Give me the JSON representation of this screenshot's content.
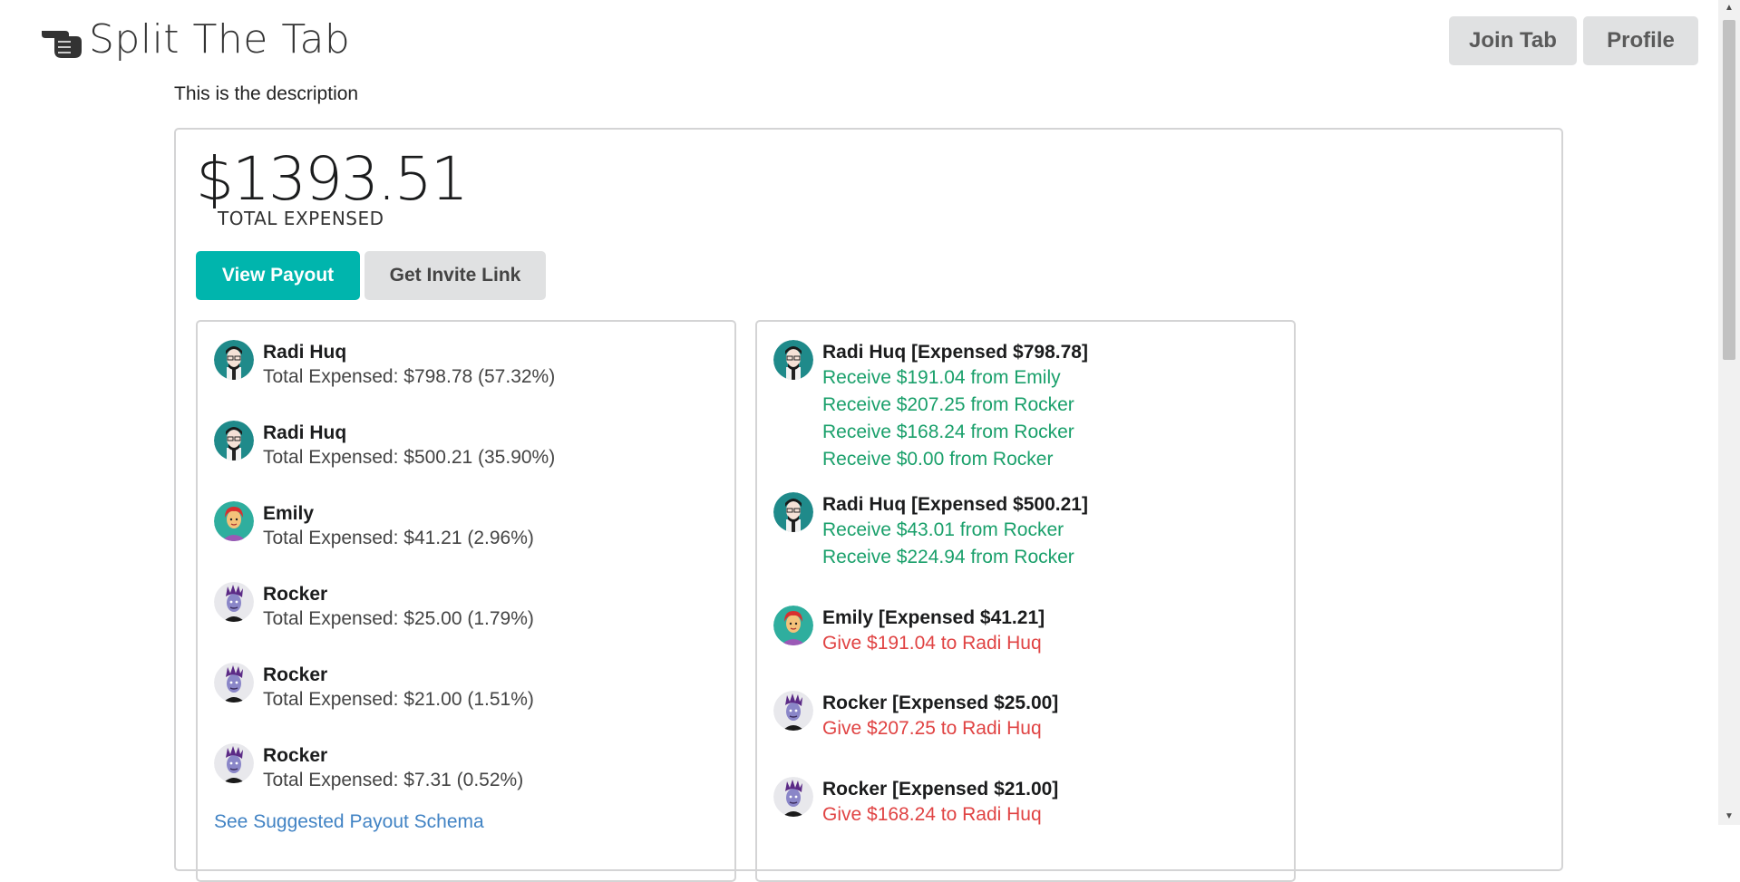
{
  "app": {
    "title": "Split The Tab",
    "logo_icon": "pointing-hand-icon"
  },
  "nav": {
    "join_label": "Join Tab",
    "profile_label": "Profile"
  },
  "tab": {
    "description": "This is the description",
    "total": "$1393.51",
    "total_label": "TOTAL EXPENSED",
    "view_payout_label": "View Payout",
    "invite_label": "Get Invite Link",
    "suggest_link": "See Suggested Payout Schema"
  },
  "colors": {
    "accent": "#00b5ad",
    "receive": "#1aa06b",
    "give": "#e04343",
    "link": "#4183c4"
  },
  "members": [
    {
      "name": "Radi Huq",
      "avatar": "radi-avatar-icon",
      "expensed": "Total Expensed: $798.78 (57.32%)"
    },
    {
      "name": "Radi Huq",
      "avatar": "radi-avatar-icon",
      "expensed": "Total Expensed: $500.21 (35.90%)"
    },
    {
      "name": "Emily",
      "avatar": "emily-avatar-icon",
      "expensed": "Total Expensed: $41.21 (2.96%)"
    },
    {
      "name": "Rocker",
      "avatar": "rocker-avatar-icon",
      "expensed": "Total Expensed: $25.00 (1.79%)"
    },
    {
      "name": "Rocker",
      "avatar": "rocker-avatar-icon",
      "expensed": "Total Expensed: $21.00 (1.51%)"
    },
    {
      "name": "Rocker",
      "avatar": "rocker-avatar-icon",
      "expensed": "Total Expensed: $7.31 (0.52%)"
    }
  ],
  "payouts": [
    {
      "title": "Radi Huq [Expensed $798.78]",
      "avatar": "radi-avatar-icon",
      "lines": [
        {
          "kind": "receive",
          "text": "Receive $191.04 from Emily"
        },
        {
          "kind": "receive",
          "text": "Receive $207.25 from Rocker"
        },
        {
          "kind": "receive",
          "text": "Receive $168.24 from Rocker"
        },
        {
          "kind": "receive",
          "text": "Receive $0.00 from Rocker"
        }
      ]
    },
    {
      "title": "Radi Huq [Expensed $500.21]",
      "avatar": "radi-avatar-icon",
      "lines": [
        {
          "kind": "receive",
          "text": "Receive $43.01 from Rocker"
        },
        {
          "kind": "receive",
          "text": "Receive $224.94 from Rocker"
        }
      ]
    },
    {
      "title": "Emily [Expensed $41.21]",
      "avatar": "emily-avatar-icon",
      "lines": [
        {
          "kind": "give",
          "text": "Give $191.04 to Radi Huq"
        }
      ]
    },
    {
      "title": "Rocker [Expensed $25.00]",
      "avatar": "rocker-avatar-icon",
      "lines": [
        {
          "kind": "give",
          "text": "Give $207.25 to Radi Huq"
        }
      ]
    },
    {
      "title": "Rocker [Expensed $21.00]",
      "avatar": "rocker-avatar-icon",
      "lines": [
        {
          "kind": "give",
          "text": "Give $168.24 to Radi Huq"
        }
      ]
    }
  ]
}
